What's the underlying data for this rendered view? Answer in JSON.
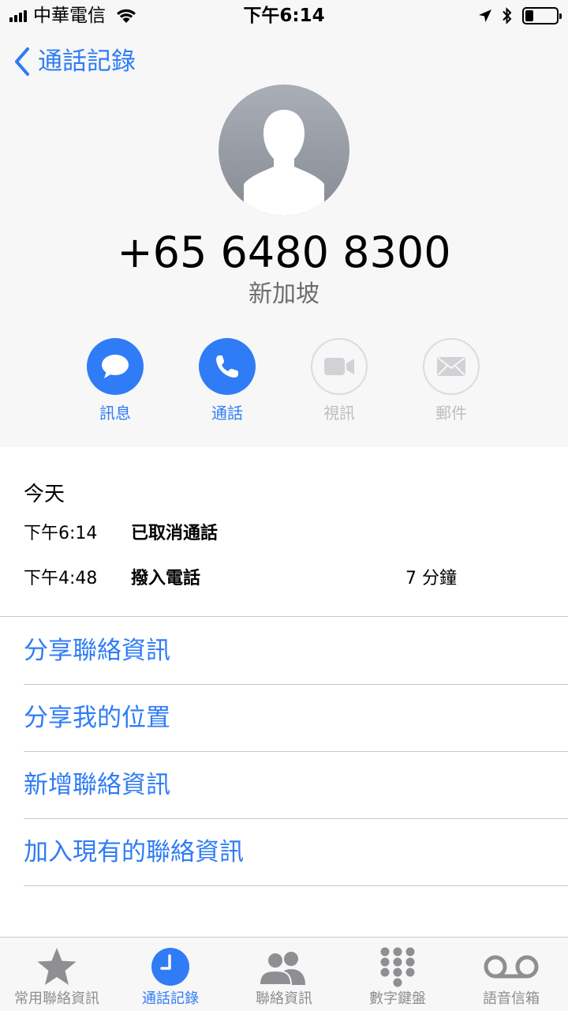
{
  "status_bar": {
    "carrier": "中華電信",
    "time": "下午6:14",
    "battery_level": 0.25
  },
  "nav": {
    "back_label": "通話記錄"
  },
  "contact": {
    "phone_number": "+65 6480 8300",
    "location": "新加坡"
  },
  "actions": [
    {
      "label": "訊息",
      "icon": "message-icon",
      "enabled": true
    },
    {
      "label": "通話",
      "icon": "phone-icon",
      "enabled": true
    },
    {
      "label": "視訊",
      "icon": "video-icon",
      "enabled": false
    },
    {
      "label": "郵件",
      "icon": "mail-icon",
      "enabled": false
    }
  ],
  "recents": {
    "title": "今天",
    "calls": [
      {
        "time": "下午6:14",
        "type": "已取消通話",
        "duration": ""
      },
      {
        "time": "下午4:48",
        "type": "撥入電話",
        "duration": "7 分鐘"
      }
    ]
  },
  "options": [
    "分享聯絡資訊",
    "分享我的位置",
    "新增聯絡資訊",
    "加入現有的聯絡資訊"
  ],
  "tabs": [
    {
      "label": "常用聯絡資訊",
      "icon": "star-icon",
      "active": false
    },
    {
      "label": "通話記錄",
      "icon": "clock-icon",
      "active": true
    },
    {
      "label": "聯絡資訊",
      "icon": "contacts-icon",
      "active": false
    },
    {
      "label": "數字鍵盤",
      "icon": "keypad-icon",
      "active": false
    },
    {
      "label": "語音信箱",
      "icon": "voicemail-icon",
      "active": false
    }
  ],
  "colors": {
    "accent": "#2f7cf6",
    "header_bg": "#f7f7f7",
    "secondary_text": "#6d6d72",
    "inactive_text": "#8e8e93"
  }
}
